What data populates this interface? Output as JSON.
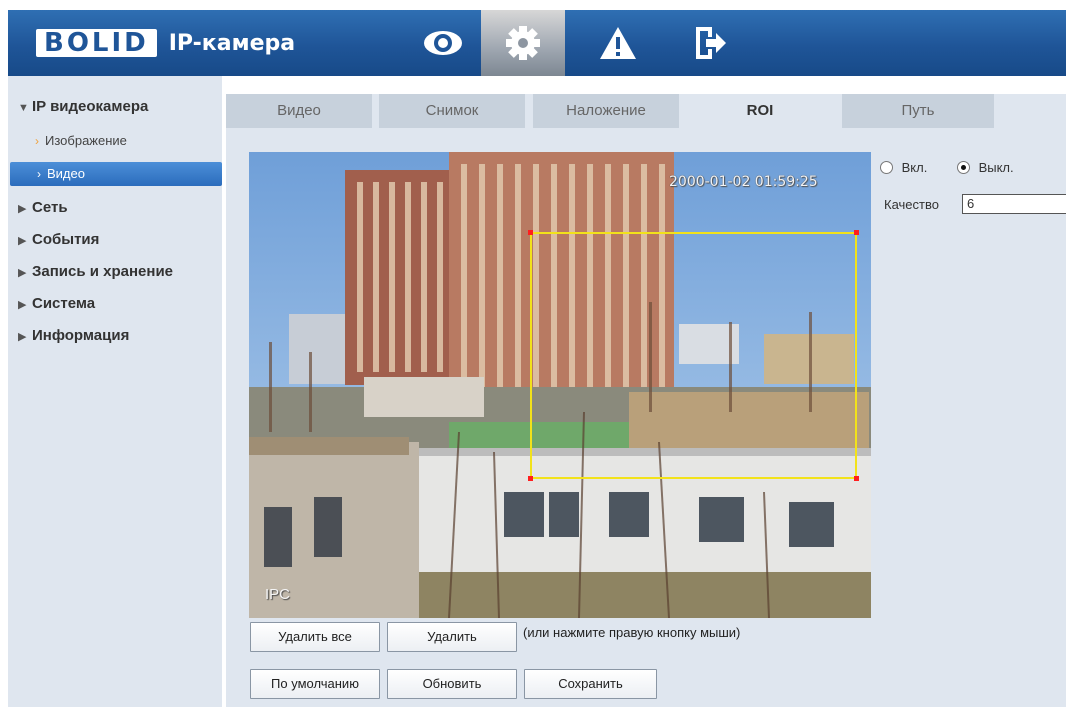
{
  "header": {
    "logo": "BOLID",
    "product": "IP-камера",
    "nav": [
      "live-view",
      "setup",
      "alarm",
      "logout"
    ]
  },
  "sidebar": {
    "items": [
      {
        "label": "IP видеокамера",
        "expanded": true
      },
      {
        "label": "Изображение",
        "sub": true
      },
      {
        "label": "Видео",
        "sub": true,
        "active": true
      },
      {
        "label": "Сеть"
      },
      {
        "label": "События"
      },
      {
        "label": "Запись и хранение"
      },
      {
        "label": "Система"
      },
      {
        "label": "Информация"
      }
    ]
  },
  "tabs": [
    "Видео",
    "Снимок",
    "Наложение",
    "ROI",
    "Путь"
  ],
  "active_tab": "ROI",
  "video": {
    "timestamp": "2000-01-02 01:59:25",
    "channel_label": "IPC"
  },
  "roi": {
    "enable_label": "Вкл.",
    "disable_label": "Выкл.",
    "selected": "Выкл.",
    "quality_label": "Качество",
    "quality_value": "6"
  },
  "buttons": {
    "delete_all": "Удалить все",
    "delete": "Удалить",
    "hint": "(или нажмите правую кнопку мыши)",
    "default": "По умолчанию",
    "refresh": "Обновить",
    "save": "Сохранить"
  },
  "colors": {
    "header": "#1f5598",
    "sidebar": "#dfe6ef",
    "active_item": "#2b6cbc",
    "roi_border": "#f2e21a",
    "roi_corner": "#ff1e1e"
  }
}
